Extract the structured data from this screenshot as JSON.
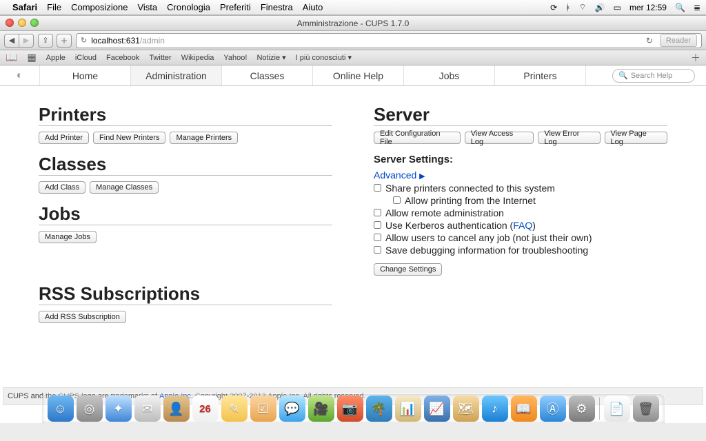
{
  "menubar": {
    "app": "Safari",
    "items": [
      "File",
      "Composizione",
      "Vista",
      "Cronologia",
      "Preferiti",
      "Finestra",
      "Aiuto"
    ],
    "datetime": "mer 12:59"
  },
  "window": {
    "title": "Amministrazione - CUPS 1.7.0",
    "url_host": "localhost:631",
    "url_path": "/admin",
    "reader_label": "Reader"
  },
  "bookmarks": [
    "Apple",
    "iCloud",
    "Facebook",
    "Twitter",
    "Wikipedia",
    "Yahoo!",
    "Notizie ▾",
    "I più conosciuti ▾"
  ],
  "cups_tabs": {
    "items": [
      "Home",
      "Administration",
      "Classes",
      "Online Help",
      "Jobs",
      "Printers"
    ],
    "active_index": 1,
    "search_placeholder": "Search Help"
  },
  "left": {
    "printers": {
      "heading": "Printers",
      "buttons": [
        "Add Printer",
        "Find New Printers",
        "Manage Printers"
      ]
    },
    "classes": {
      "heading": "Classes",
      "buttons": [
        "Add Class",
        "Manage Classes"
      ]
    },
    "jobs": {
      "heading": "Jobs",
      "buttons": [
        "Manage Jobs"
      ]
    },
    "rss": {
      "heading": "RSS Subscriptions",
      "buttons": [
        "Add RSS Subscription"
      ]
    }
  },
  "right": {
    "server": {
      "heading": "Server",
      "buttons": [
        "Edit Configuration File",
        "View Access Log",
        "View Error Log",
        "View Page Log"
      ]
    },
    "settings_heading": "Server Settings:",
    "advanced_label": "Advanced",
    "options": {
      "o1": "Share printers connected to this system",
      "o1a": "Allow printing from the Internet",
      "o2": "Allow remote administration",
      "o3_pre": "Use Kerberos authentication (",
      "o3_link": "FAQ",
      "o3_post": ")",
      "o4": "Allow users to cancel any job (not just their own)",
      "o5": "Save debugging information for troubleshooting"
    },
    "change_button": "Change Settings"
  },
  "footer": {
    "t1": "CUPS and the CUPS logo are trademarks of ",
    "link": "Apple Inc.",
    "t2": " Copyright 2007-2013 Apple Inc. All rights reserved."
  },
  "dock": {
    "items": [
      {
        "name": "finder",
        "bg": "linear-gradient(#6fb9f2,#2d78c9)",
        "glyph": "☺"
      },
      {
        "name": "launchpad",
        "bg": "linear-gradient(#c7c7c7,#8a8a8a)",
        "glyph": "◎"
      },
      {
        "name": "safari",
        "bg": "linear-gradient(#bfe1ff,#3f86d8)",
        "glyph": "✦"
      },
      {
        "name": "mail",
        "bg": "linear-gradient(#f3f3f3,#bcbcbc)",
        "glyph": "✉"
      },
      {
        "name": "contacts",
        "bg": "linear-gradient(#e6c68f,#b8894c)",
        "glyph": "👤"
      },
      {
        "name": "calendar",
        "bg": "linear-gradient(#ffffff,#efefef)",
        "glyph": "26"
      },
      {
        "name": "notes",
        "bg": "linear-gradient(#ffe79a,#f3c24e)",
        "glyph": "✎"
      },
      {
        "name": "reminders",
        "bg": "linear-gradient(#fbd6a3,#e9a44f)",
        "glyph": "☑"
      },
      {
        "name": "messages",
        "bg": "linear-gradient(#b5e8ff,#3aa3ea)",
        "glyph": "💬"
      },
      {
        "name": "facetime",
        "bg": "linear-gradient(#c2e48c,#5aa72e)",
        "glyph": "🎥"
      },
      {
        "name": "photobooth",
        "bg": "linear-gradient(#ff8e6b,#d34b29)",
        "glyph": "📷"
      },
      {
        "name": "iphoto",
        "bg": "linear-gradient(#5db3ec,#2e7ab7)",
        "glyph": "🌴"
      },
      {
        "name": "numbers",
        "bg": "linear-gradient(#f6e9c8,#d2b778)",
        "glyph": "📊"
      },
      {
        "name": "keynote",
        "bg": "linear-gradient(#7fb1e7,#3a6fae)",
        "glyph": "📈"
      },
      {
        "name": "maps",
        "bg": "linear-gradient(#f6dca4,#cfa253)",
        "glyph": "🗺"
      },
      {
        "name": "itunes",
        "bg": "linear-gradient(#6cc7ff,#1a7fd4)",
        "glyph": "♪"
      },
      {
        "name": "ibooks",
        "bg": "linear-gradient(#ffb760,#ee8a1e)",
        "glyph": "📖"
      },
      {
        "name": "appstore",
        "bg": "linear-gradient(#8fcdff,#2c86d6)",
        "glyph": "Ⓐ"
      },
      {
        "name": "sysprefs",
        "bg": "linear-gradient(#bfbfbf,#7b7b7b)",
        "glyph": "⚙"
      }
    ],
    "items_after_sep": [
      {
        "name": "document",
        "bg": "linear-gradient(#ffffff,#e6e6e6)",
        "glyph": "📄"
      },
      {
        "name": "trash",
        "bg": "linear-gradient(#cfcfcf,#8f8f8f)",
        "glyph": "🗑"
      }
    ]
  }
}
